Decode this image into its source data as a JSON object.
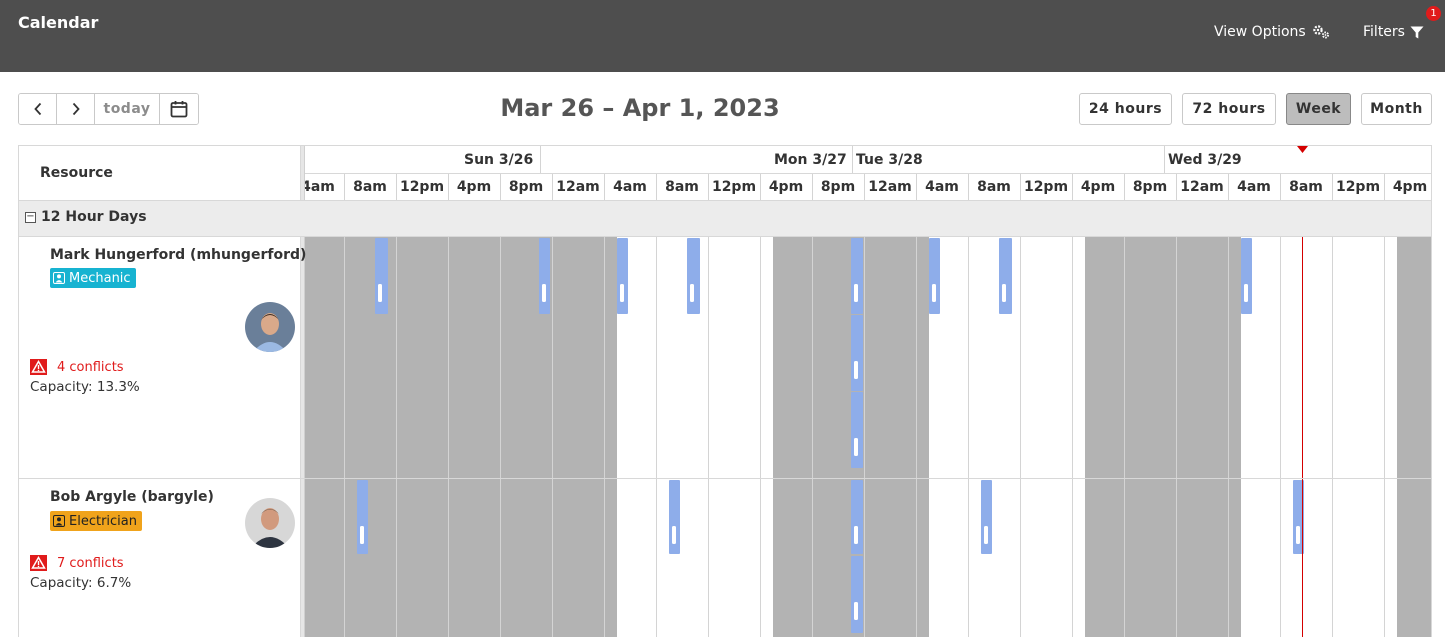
{
  "app": {
    "title": "Calendar",
    "view_options_label": "View Options",
    "filters_label": "Filters",
    "filters_badge": "1"
  },
  "toolbar": {
    "today_label": "today",
    "range_title": "Mar 26 – Apr 1, 2023",
    "views": [
      {
        "label": "24 hours",
        "active": false
      },
      {
        "label": "72 hours",
        "active": false
      },
      {
        "label": "Week",
        "active": true
      },
      {
        "label": "Month",
        "active": false
      }
    ]
  },
  "grid": {
    "resource_header": "Resource",
    "days": [
      "Sun 3/26",
      "Mon 3/27",
      "Tue 3/28",
      "Wed 3/29"
    ],
    "hour_labels": [
      "4am",
      "8am",
      "12pm",
      "4pm",
      "8pm",
      "12am",
      "4am",
      "8am",
      "12pm",
      "4pm",
      "8pm",
      "12am",
      "4am",
      "8am",
      "12pm",
      "4pm",
      "8pm",
      "12am",
      "4am",
      "8am",
      "12pm",
      "4pm"
    ]
  },
  "group": {
    "label": "12 Hour Days",
    "toggle": "−"
  },
  "resources": [
    {
      "name": "Mark Hungerford (mhungerford)",
      "role": "Mechanic",
      "conflicts": "4 conflicts",
      "capacity": "Capacity: 13.3%"
    },
    {
      "name": "Bob Argyle (bargyle)",
      "role": "Electrician",
      "conflicts": "7 conflicts",
      "capacity": "Capacity: 6.7%"
    }
  ],
  "colors": {
    "header_bg": "#4e4e4e",
    "unavailable": "#b3b3b3",
    "event": "#8eadea",
    "now_line": "#d40000",
    "mechanic": "#17b3d1",
    "electrician": "#f0a31b",
    "conflict": "#e01b1b"
  }
}
